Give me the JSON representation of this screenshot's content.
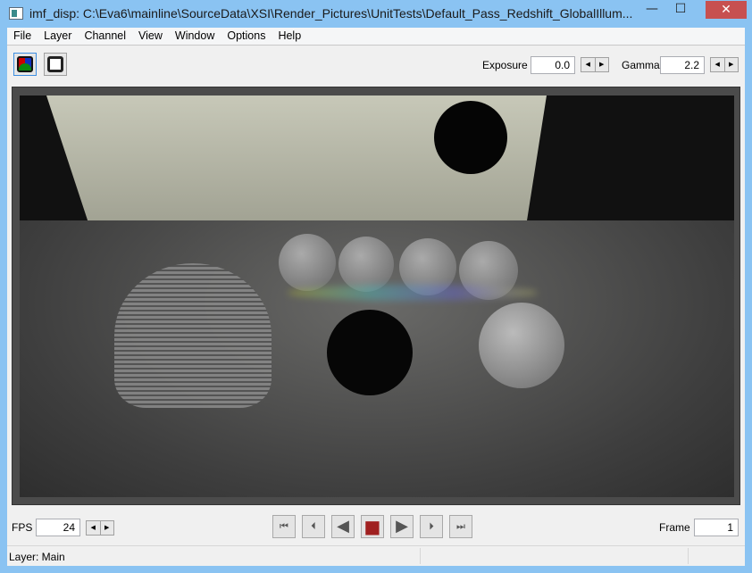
{
  "window": {
    "title": "imf_disp: C:\\Eva6\\mainline\\SourceData\\XSI\\Render_Pictures\\UnitTests\\Default_Pass_Redshift_GlobalIllum...",
    "minimize": "—",
    "maximize": "☐",
    "close": "✕"
  },
  "menu": [
    "File",
    "Layer",
    "Channel",
    "View",
    "Window",
    "Options",
    "Help"
  ],
  "toolbar": {
    "rgb_icon": "rgb-channel-icon",
    "alpha_icon": "alpha-channel-icon",
    "exposure_label": "Exposure",
    "exposure_value": "0.0",
    "gamma_label": "Gamma",
    "gamma_value": "2.2"
  },
  "playback": {
    "fps_label": "FPS",
    "fps_value": "24",
    "frame_label": "Frame",
    "frame_value": "1",
    "buttons": [
      "⏮",
      "⏴",
      "◀",
      "■",
      "▶",
      "⏵",
      "⏭"
    ]
  },
  "status": {
    "layer": "Layer: Main"
  }
}
